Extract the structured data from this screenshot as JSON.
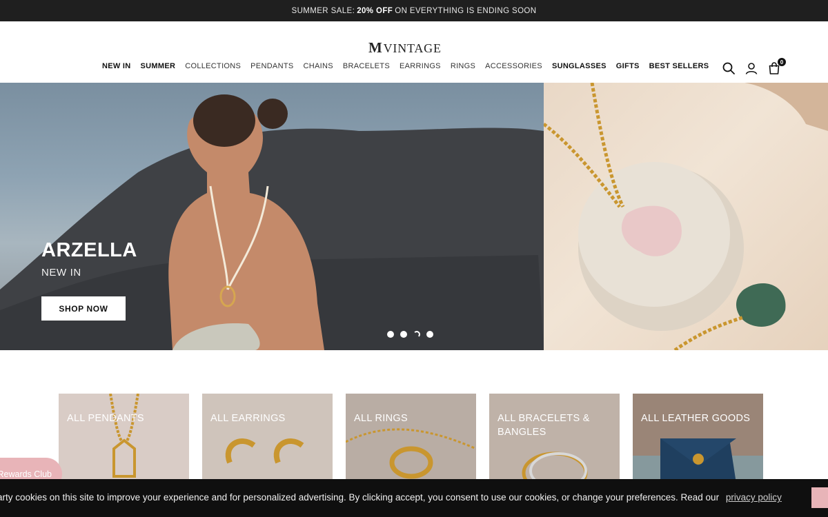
{
  "announcement": {
    "prefix": "SUMMER SALE:",
    "highlight": "20% OFF",
    "suffix": "ON EVERYTHING IS ENDING SOON"
  },
  "header": {
    "logo_mark": "M",
    "logo_text": "VINTAGE",
    "nav": [
      {
        "label": "NEW IN",
        "bold": true
      },
      {
        "label": "SUMMER",
        "bold": true
      },
      {
        "label": "COLLECTIONS",
        "bold": false
      },
      {
        "label": "PENDANTS",
        "bold": false
      },
      {
        "label": "CHAINS",
        "bold": false
      },
      {
        "label": "BRACELETS",
        "bold": false
      },
      {
        "label": "EARRINGS",
        "bold": false
      },
      {
        "label": "RINGS",
        "bold": false
      },
      {
        "label": "ACCESSORIES",
        "bold": false
      },
      {
        "label": "SUNGLASSES",
        "bold": true
      },
      {
        "label": "GIFTS",
        "bold": true
      },
      {
        "label": "BEST SELLERS",
        "bold": true
      }
    ],
    "icons": [
      "search-icon",
      "account-icon",
      "cart-icon"
    ],
    "cart_count": "0"
  },
  "hero": {
    "title": "ARZELLA",
    "subtitle": "NEW IN",
    "button_label": "SHOP NOW",
    "slides": 4,
    "active_slide": 3
  },
  "categories": [
    {
      "label": "ALL PENDANTS",
      "color": "#d9ccc6"
    },
    {
      "label": "ALL EARRINGS",
      "color": "#cfc4bb"
    },
    {
      "label": "ALL RINGS",
      "color": "#b9ada4"
    },
    {
      "label": "ALL BRACELETS & BANGLES",
      "color": "#bfb2a8"
    },
    {
      "label": "ALL LEATHER GOODS",
      "color": "#9a8577"
    }
  ],
  "rewards": {
    "label": "Rewards Club"
  },
  "cookie": {
    "text": "arty cookies on this site to improve your experience and for personalized advertising. By clicking accept, you consent to use our cookies, or change your preferences. Read our",
    "link": "privacy policy"
  },
  "colors": {
    "announce_bg": "#1f1f1f",
    "rewards_pink": "#e8b4b8",
    "cookie_bg": "#0f0f0f"
  }
}
